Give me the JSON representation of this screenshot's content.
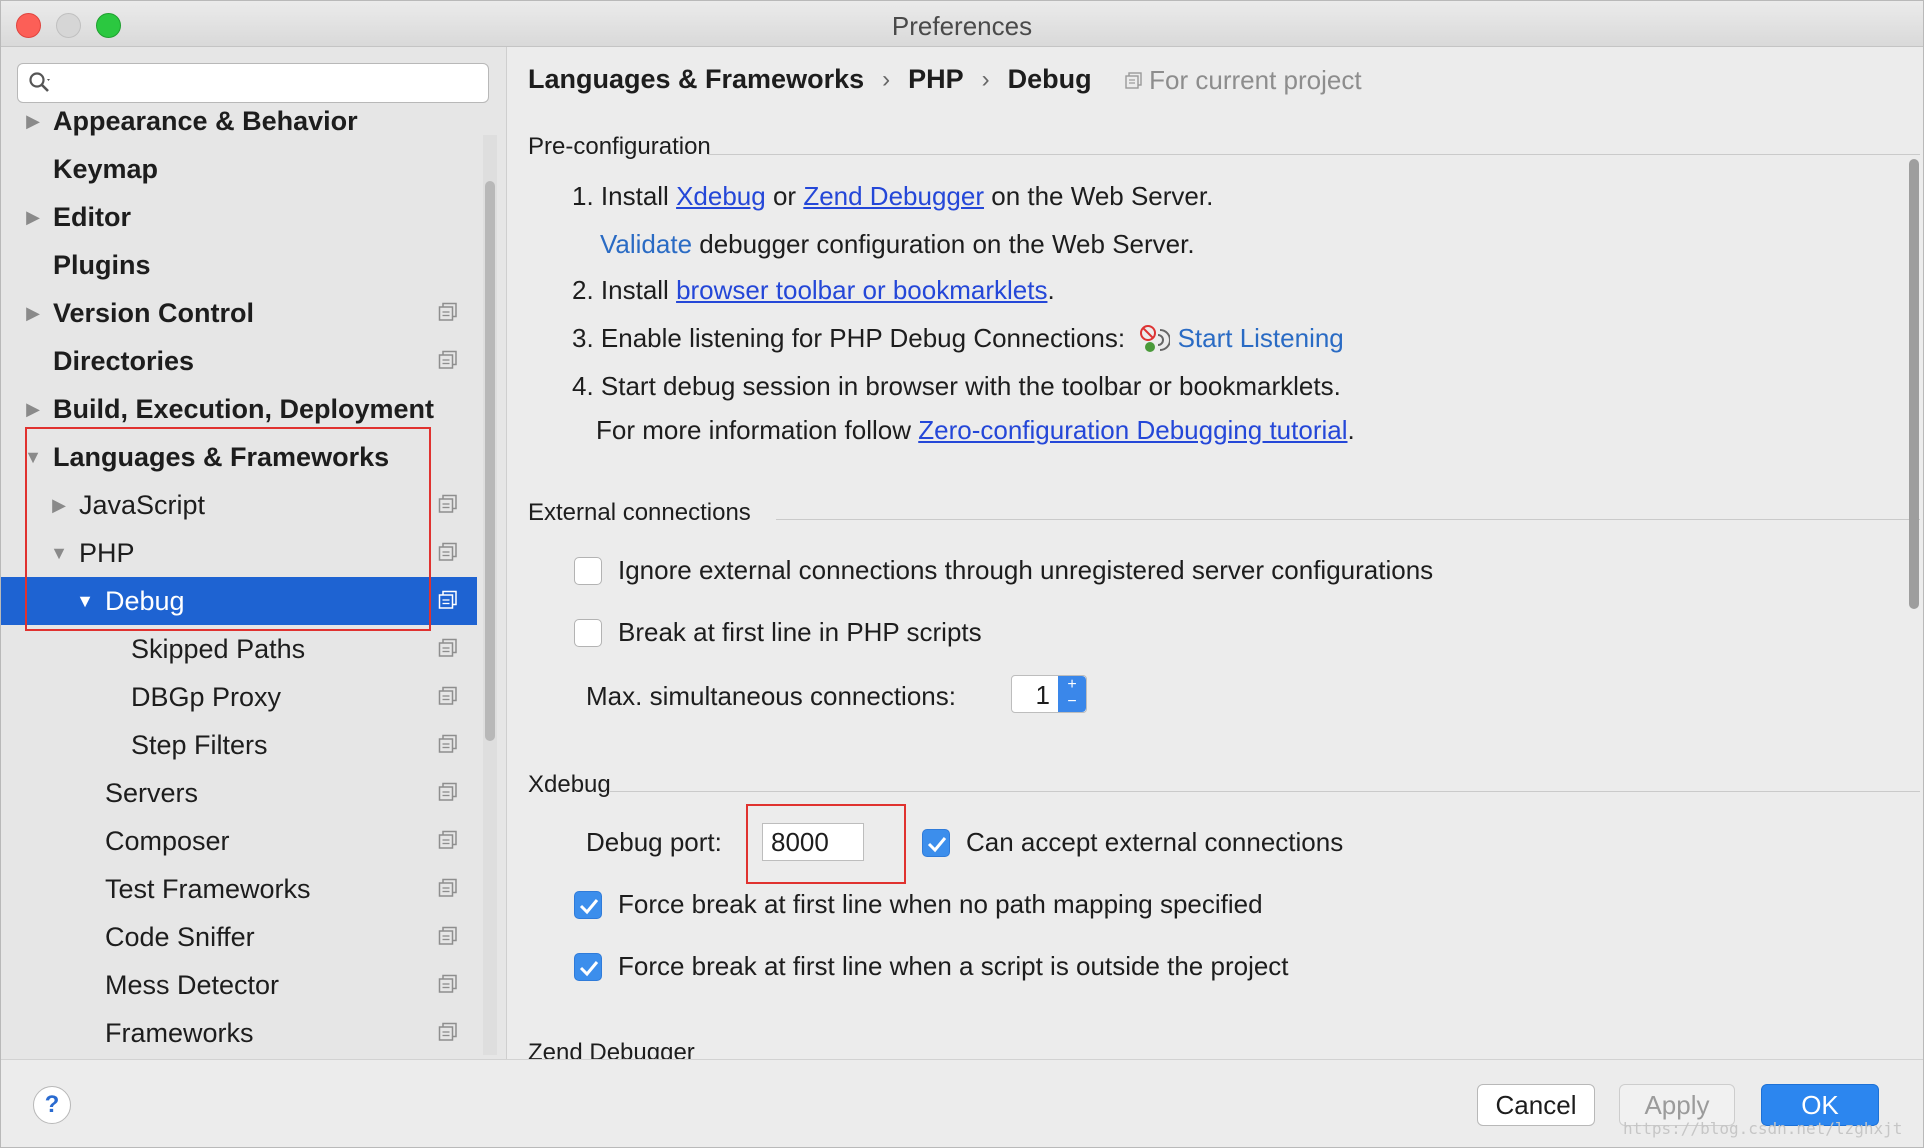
{
  "window": {
    "title": "Preferences"
  },
  "search": {
    "placeholder": "",
    "value": ""
  },
  "tree": [
    {
      "label": "Appearance & Behavior",
      "bold": true,
      "arrow": "right",
      "indent": 0,
      "project": false
    },
    {
      "label": "Keymap",
      "bold": true,
      "arrow": "",
      "indent": 0,
      "project": false
    },
    {
      "label": "Editor",
      "bold": true,
      "arrow": "right",
      "indent": 0,
      "project": false
    },
    {
      "label": "Plugins",
      "bold": true,
      "arrow": "",
      "indent": 0,
      "project": false
    },
    {
      "label": "Version Control",
      "bold": true,
      "arrow": "right",
      "indent": 0,
      "project": true
    },
    {
      "label": "Directories",
      "bold": true,
      "arrow": "",
      "indent": 0,
      "project": true
    },
    {
      "label": "Build, Execution, Deployment",
      "bold": true,
      "arrow": "right",
      "indent": 0,
      "project": false
    },
    {
      "label": "Languages & Frameworks",
      "bold": true,
      "arrow": "down",
      "indent": 0,
      "project": false
    },
    {
      "label": "JavaScript",
      "bold": false,
      "arrow": "right",
      "indent": 1,
      "project": true
    },
    {
      "label": "PHP",
      "bold": false,
      "arrow": "down",
      "indent": 1,
      "project": true
    },
    {
      "label": "Debug",
      "bold": false,
      "arrow": "down",
      "indent": 2,
      "project": true,
      "selected": true
    },
    {
      "label": "Skipped Paths",
      "bold": false,
      "arrow": "",
      "indent": 3,
      "project": true
    },
    {
      "label": "DBGp Proxy",
      "bold": false,
      "arrow": "",
      "indent": 3,
      "project": true
    },
    {
      "label": "Step Filters",
      "bold": false,
      "arrow": "",
      "indent": 3,
      "project": true
    },
    {
      "label": "Servers",
      "bold": false,
      "arrow": "",
      "indent": 2,
      "project": true
    },
    {
      "label": "Composer",
      "bold": false,
      "arrow": "",
      "indent": 2,
      "project": true
    },
    {
      "label": "Test Frameworks",
      "bold": false,
      "arrow": "",
      "indent": 2,
      "project": true
    },
    {
      "label": "Code Sniffer",
      "bold": false,
      "arrow": "",
      "indent": 2,
      "project": true
    },
    {
      "label": "Mess Detector",
      "bold": false,
      "arrow": "",
      "indent": 2,
      "project": true
    },
    {
      "label": "Frameworks",
      "bold": false,
      "arrow": "",
      "indent": 2,
      "project": true
    }
  ],
  "breadcrumb": {
    "items": [
      "Languages & Frameworks",
      "PHP",
      "Debug"
    ],
    "separator": "›",
    "scope": "For current project"
  },
  "preconfig": {
    "title": "Pre-configuration",
    "step1_prefix": "1. Install",
    "step1_link1": "Xdebug",
    "step1_or": "or",
    "step1_link2": "Zend Debugger",
    "step1_suffix": "on the Web Server.",
    "validate_link": "Validate",
    "validate_text": "debugger configuration on the Web Server.",
    "step2_prefix": "2. Install",
    "step2_link": "browser toolbar or bookmarklets",
    "step2_suffix": ".",
    "step3_text": "3. Enable listening for PHP Debug Connections:",
    "step3_link": "Start Listening",
    "step4_text": "4. Start debug session in browser with the toolbar or bookmarklets.",
    "more_prefix": "For more information follow",
    "more_link": "Zero-configuration Debugging tutorial",
    "more_suffix": "."
  },
  "external": {
    "title": "External connections",
    "ignore_label": "Ignore external connections through unregistered server configurations",
    "ignore_checked": false,
    "break_first_label": "Break at first line in PHP scripts",
    "break_first_checked": false,
    "max_label": "Max. simultaneous connections:",
    "max_value": "1",
    "spinner_up": "+",
    "spinner_down": "−"
  },
  "xdebug": {
    "title": "Xdebug",
    "port_label": "Debug port:",
    "port_value": "8000",
    "accept_label": "Can accept external connections",
    "accept_checked": true,
    "force_nomap_label": "Force break at first line when no path mapping specified",
    "force_nomap_checked": true,
    "force_outside_label": "Force break at first line when a script is outside the project",
    "force_outside_checked": true
  },
  "zend": {
    "title": "Zend Debugger"
  },
  "footer": {
    "help": "?",
    "cancel": "Cancel",
    "apply": "Apply",
    "ok": "OK",
    "watermark": "https://blog.csdn.net/lzghxjt"
  },
  "colors": {
    "selection": "#1e63d2",
    "link": "#2447d8",
    "accent": "#2c86ef",
    "highlight_box": "#e0322f"
  }
}
